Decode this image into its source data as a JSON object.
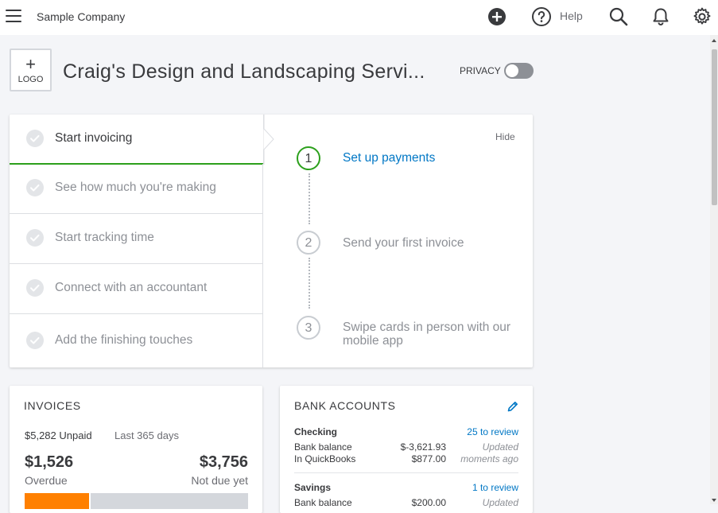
{
  "topbar": {
    "company_name": "Sample Company",
    "help_label": "Help"
  },
  "header": {
    "logo_plus": "+",
    "logo_label": "LOGO",
    "business_name": "Craig's Design and Landscaping Servi...",
    "privacy_label": "PRIVACY",
    "privacy_enabled": false
  },
  "setup": {
    "hide_label": "Hide",
    "tasks": [
      {
        "label": "Start invoicing",
        "active": true
      },
      {
        "label": "See how much you're making",
        "active": false
      },
      {
        "label": "Start tracking time",
        "active": false
      },
      {
        "label": "Connect with an accountant",
        "active": false
      },
      {
        "label": "Add the finishing touches",
        "active": false
      }
    ],
    "steps": [
      {
        "number": "1",
        "label": "Set up payments",
        "active": true
      },
      {
        "number": "2",
        "label": "Send your first invoice",
        "active": false
      },
      {
        "number": "3",
        "label": "Swipe cards in person with our mobile app",
        "active": false
      }
    ]
  },
  "invoices": {
    "title": "INVOICES",
    "unpaid": "$5,282 Unpaid",
    "period": "Last 365 days",
    "overdue_amount": "$1,526",
    "overdue_label": "Overdue",
    "notdue_amount": "$3,756",
    "notdue_label": "Not due yet",
    "overdue_fraction": 0.29,
    "colors": {
      "overdue": "#ff8000",
      "notdue": "#d4d7dc"
    }
  },
  "bank": {
    "title": "BANK ACCOUNTS",
    "accounts": [
      {
        "name": "Checking",
        "review": "25 to review",
        "bank_balance_label": "Bank balance",
        "bank_balance": "$-3,621.93",
        "qb_label": "In QuickBooks",
        "qb_balance": "$877.00",
        "updated_1": "Updated",
        "updated_2": "moments ago"
      },
      {
        "name": "Savings",
        "review": "1 to review",
        "bank_balance_label": "Bank balance",
        "bank_balance": "$200.00",
        "updated_1": "Updated"
      }
    ]
  },
  "colors": {
    "accent_green": "#2ca01c",
    "link_blue": "#0077c5",
    "text": "#393a3d",
    "muted": "#8d9096"
  }
}
